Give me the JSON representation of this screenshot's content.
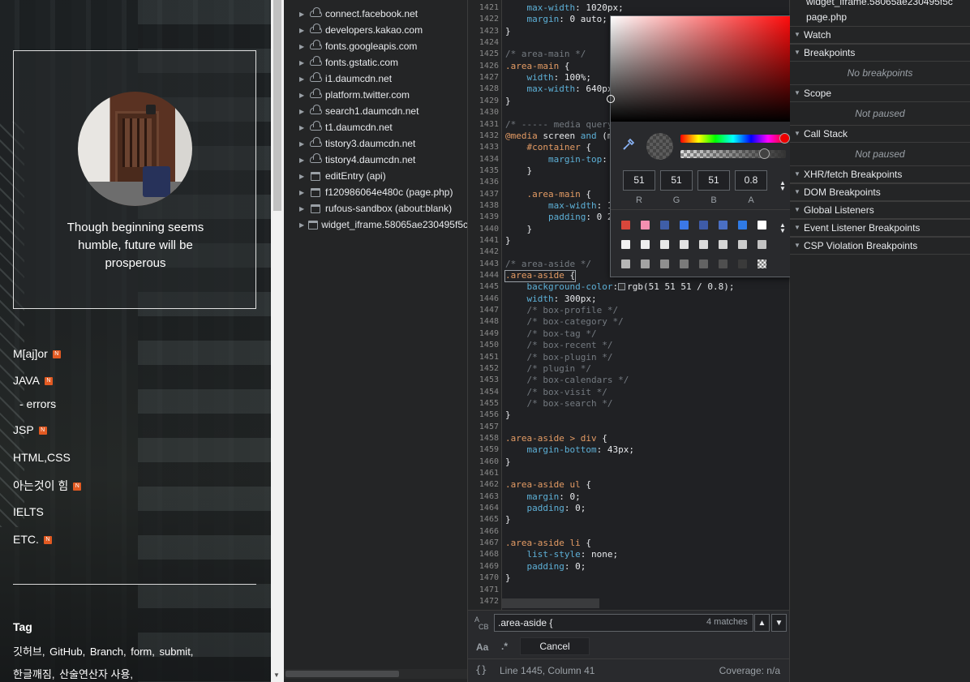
{
  "blog": {
    "profile_text": "Though beginning seems humble, future will be prosperous",
    "categories": [
      {
        "label": "M[aj]or",
        "badge": "N"
      },
      {
        "label": "JAVA",
        "badge": "N"
      },
      {
        "label": "- errors",
        "badge": ""
      },
      {
        "label": "JSP",
        "badge": "N"
      },
      {
        "label": "HTML,CSS",
        "badge": ""
      },
      {
        "label": "아는것이 힘",
        "badge": "N"
      },
      {
        "label": "IELTS",
        "badge": ""
      },
      {
        "label": "ETC.",
        "badge": "N"
      }
    ],
    "tag_title": "Tag",
    "tags_row1": [
      "깃허브,",
      "GitHub,",
      "Branch,",
      "form,",
      "submit,"
    ],
    "tags_row2": [
      "한글깨짐,",
      "산술연산자 사용,"
    ]
  },
  "tree": {
    "items": [
      {
        "label": "connect.facebook.net",
        "icon": "cloud"
      },
      {
        "label": "developers.kakao.com",
        "icon": "cloud"
      },
      {
        "label": "fonts.googleapis.com",
        "icon": "cloud"
      },
      {
        "label": "fonts.gstatic.com",
        "icon": "cloud"
      },
      {
        "label": "i1.daumcdn.net",
        "icon": "cloud"
      },
      {
        "label": "platform.twitter.com",
        "icon": "cloud"
      },
      {
        "label": "search1.daumcdn.net",
        "icon": "cloud"
      },
      {
        "label": "t1.daumcdn.net",
        "icon": "cloud"
      },
      {
        "label": "tistory3.daumcdn.net",
        "icon": "cloud"
      },
      {
        "label": "tistory4.daumcdn.net",
        "icon": "cloud"
      },
      {
        "label": "editEntry (api)",
        "icon": "frame"
      },
      {
        "label": "f120986064e480c (page.php)",
        "icon": "frame"
      },
      {
        "label": "rufous-sandbox (about:blank)",
        "icon": "frame"
      },
      {
        "label": "widget_iframe.58065ae230495f5c",
        "icon": "frame"
      }
    ]
  },
  "editor": {
    "lines": [
      {
        "n": "1421",
        "parts": [
          [
            "",
            "    "
          ],
          [
            "c-prop",
            "max-width"
          ],
          [
            "",
            ": 1020px;"
          ]
        ]
      },
      {
        "n": "1422",
        "parts": [
          [
            "",
            "    "
          ],
          [
            "c-prop",
            "margin"
          ],
          [
            "",
            ": 0 auto;"
          ]
        ]
      },
      {
        "n": "1423",
        "parts": [
          [
            "",
            "}"
          ]
        ]
      },
      {
        "n": "1424",
        "parts": []
      },
      {
        "n": "1425",
        "parts": [
          [
            "c-comment",
            "/* area-main */"
          ]
        ]
      },
      {
        "n": "1426",
        "parts": [
          [
            "c-sel",
            ".area-main"
          ],
          [
            "",
            " {"
          ]
        ]
      },
      {
        "n": "1427",
        "parts": [
          [
            "",
            "    "
          ],
          [
            "c-prop",
            "width"
          ],
          [
            "",
            ": 100%;"
          ]
        ]
      },
      {
        "n": "1428",
        "parts": [
          [
            "",
            "    "
          ],
          [
            "c-prop",
            "max-width"
          ],
          [
            "",
            ": 640px"
          ]
        ]
      },
      {
        "n": "1429",
        "parts": [
          [
            "",
            "}"
          ]
        ]
      },
      {
        "n": "1430",
        "parts": []
      },
      {
        "n": "1431",
        "parts": [
          [
            "c-comment",
            "/* ----- media query"
          ]
        ]
      },
      {
        "n": "1432",
        "parts": [
          [
            "c-key",
            "@media"
          ],
          [
            "",
            " screen "
          ],
          [
            "c-prop",
            "and"
          ],
          [
            "",
            " (m"
          ]
        ]
      },
      {
        "n": "1433",
        "parts": [
          [
            "",
            "    "
          ],
          [
            "c-sel",
            "#container"
          ],
          [
            "",
            " {"
          ]
        ]
      },
      {
        "n": "1434",
        "parts": [
          [
            "",
            "        "
          ],
          [
            "c-prop",
            "margin-top"
          ],
          [
            "",
            ":"
          ]
        ]
      },
      {
        "n": "1435",
        "parts": [
          [
            "",
            "    }"
          ]
        ]
      },
      {
        "n": "1436",
        "parts": []
      },
      {
        "n": "1437",
        "parts": [
          [
            "",
            "    "
          ],
          [
            "c-sel",
            ".area-main"
          ],
          [
            "",
            " {"
          ]
        ]
      },
      {
        "n": "1438",
        "parts": [
          [
            "",
            "        "
          ],
          [
            "c-prop",
            "max-width"
          ],
          [
            "",
            ": 1"
          ]
        ]
      },
      {
        "n": "1439",
        "parts": [
          [
            "",
            "        "
          ],
          [
            "c-prop",
            "padding"
          ],
          [
            "",
            ": 0 2"
          ]
        ]
      },
      {
        "n": "1440",
        "parts": [
          [
            "",
            "    }"
          ]
        ]
      },
      {
        "n": "1441",
        "parts": [
          [
            "",
            "}"
          ]
        ]
      },
      {
        "n": "1442",
        "parts": []
      },
      {
        "n": "1443",
        "parts": [
          [
            "c-comment",
            "/* area-aside */"
          ]
        ]
      },
      {
        "n": "1444",
        "parts": [
          [
            "c-sel",
            ".area-aside"
          ],
          [
            "",
            " {"
          ]
        ]
      },
      {
        "n": "1445",
        "parts": [
          [
            "",
            "    "
          ],
          [
            "c-prop",
            "background-color"
          ],
          [
            "",
            ":"
          ],
          [
            "swatch",
            ""
          ],
          [
            "",
            "rgb(51 51 51 / 0.8);"
          ]
        ]
      },
      {
        "n": "1446",
        "parts": [
          [
            "",
            "    "
          ],
          [
            "c-prop",
            "width"
          ],
          [
            "",
            ": 300px;"
          ]
        ]
      },
      {
        "n": "1447",
        "parts": [
          [
            "",
            "    "
          ],
          [
            "c-comment",
            "/* box-profile */"
          ]
        ]
      },
      {
        "n": "1448",
        "parts": [
          [
            "",
            "    "
          ],
          [
            "c-comment",
            "/* box-category */"
          ]
        ]
      },
      {
        "n": "1449",
        "parts": [
          [
            "",
            "    "
          ],
          [
            "c-comment",
            "/* box-tag */"
          ]
        ]
      },
      {
        "n": "1450",
        "parts": [
          [
            "",
            "    "
          ],
          [
            "c-comment",
            "/* box-recent */"
          ]
        ]
      },
      {
        "n": "1451",
        "parts": [
          [
            "",
            "    "
          ],
          [
            "c-comment",
            "/* box-plugin */"
          ]
        ]
      },
      {
        "n": "1452",
        "parts": [
          [
            "",
            "    "
          ],
          [
            "c-comment",
            "/* plugin */"
          ]
        ]
      },
      {
        "n": "1453",
        "parts": [
          [
            "",
            "    "
          ],
          [
            "c-comment",
            "/* box-calendars */"
          ]
        ]
      },
      {
        "n": "1454",
        "parts": [
          [
            "",
            "    "
          ],
          [
            "c-comment",
            "/* box-visit */"
          ]
        ]
      },
      {
        "n": "1455",
        "parts": [
          [
            "",
            "    "
          ],
          [
            "c-comment",
            "/* box-search */"
          ]
        ]
      },
      {
        "n": "1456",
        "parts": [
          [
            "",
            "}"
          ]
        ]
      },
      {
        "n": "1457",
        "parts": []
      },
      {
        "n": "1458",
        "parts": [
          [
            "c-sel",
            ".area-aside > div"
          ],
          [
            "",
            " {"
          ]
        ]
      },
      {
        "n": "1459",
        "parts": [
          [
            "",
            "    "
          ],
          [
            "c-prop",
            "margin-bottom"
          ],
          [
            "",
            ": 43px;"
          ]
        ]
      },
      {
        "n": "1460",
        "parts": [
          [
            "",
            "}"
          ]
        ]
      },
      {
        "n": "1461",
        "parts": []
      },
      {
        "n": "1462",
        "parts": [
          [
            "c-sel",
            ".area-aside ul"
          ],
          [
            "",
            " {"
          ]
        ]
      },
      {
        "n": "1463",
        "parts": [
          [
            "",
            "    "
          ],
          [
            "c-prop",
            "margin"
          ],
          [
            "",
            ": 0;"
          ]
        ]
      },
      {
        "n": "1464",
        "parts": [
          [
            "",
            "    "
          ],
          [
            "c-prop",
            "padding"
          ],
          [
            "",
            ": 0;"
          ]
        ]
      },
      {
        "n": "1465",
        "parts": [
          [
            "",
            "}"
          ]
        ]
      },
      {
        "n": "1466",
        "parts": []
      },
      {
        "n": "1467",
        "parts": [
          [
            "c-sel",
            ".area-aside li"
          ],
          [
            "",
            " {"
          ]
        ]
      },
      {
        "n": "1468",
        "parts": [
          [
            "",
            "    "
          ],
          [
            "c-prop",
            "list-style"
          ],
          [
            "",
            ": none;"
          ]
        ]
      },
      {
        "n": "1469",
        "parts": [
          [
            "",
            "    "
          ],
          [
            "c-prop",
            "padding"
          ],
          [
            "",
            ": 0;"
          ]
        ]
      },
      {
        "n": "1470",
        "parts": [
          [
            "",
            "}"
          ]
        ]
      },
      {
        "n": "1471",
        "parts": []
      },
      {
        "n": "1472",
        "parts": []
      }
    ],
    "search": {
      "value": ".area-aside {",
      "matches": "4 matches",
      "case_label": "Aa",
      "regex_label": ".*",
      "cancel_label": "Cancel"
    },
    "status": {
      "braces": "{}",
      "position": "Line 1445, Column 41",
      "coverage": "Coverage: n/a"
    }
  },
  "picker": {
    "r": "51",
    "g": "51",
    "b": "51",
    "a": "0.8",
    "labels": [
      "R",
      "G",
      "B",
      "A"
    ],
    "hue": 0.99,
    "alpha": 0.8,
    "palette": [
      "#d9473b",
      "#f48fb1",
      "#3f5ea8",
      "#3b78e7",
      "#3e5ba8",
      "#4a6fc3",
      "#2f7ae5",
      "#ffffff",
      "#f1f1f1",
      "#eeeeee",
      "#e8e8e8",
      "#e3e3e3",
      "#dcdcdc",
      "#d5d5d5",
      "#cccccc",
      "#c3c3c3",
      "#b6b6b6",
      "#a3a3a3",
      "#8f8f8f",
      "#7a7a7a",
      "#636363",
      "#4f4f4f",
      "#3a3a3a",
      "checker"
    ]
  },
  "debug": {
    "files": [
      "widget_iframe.58065ae230495f5c",
      "page.php"
    ],
    "sections": [
      {
        "title": "Watch",
        "msg": ""
      },
      {
        "title": "Breakpoints",
        "msg": "No breakpoints"
      },
      {
        "title": "Scope",
        "msg": "Not paused"
      },
      {
        "title": "Call Stack",
        "msg": "Not paused"
      },
      {
        "title": "XHR/fetch Breakpoints",
        "msg": ""
      },
      {
        "title": "DOM Breakpoints",
        "msg": ""
      },
      {
        "title": "Global Listeners",
        "msg": ""
      },
      {
        "title": "Event Listener Breakpoints",
        "msg": ""
      },
      {
        "title": "CSP Violation Breakpoints",
        "msg": ""
      }
    ]
  }
}
